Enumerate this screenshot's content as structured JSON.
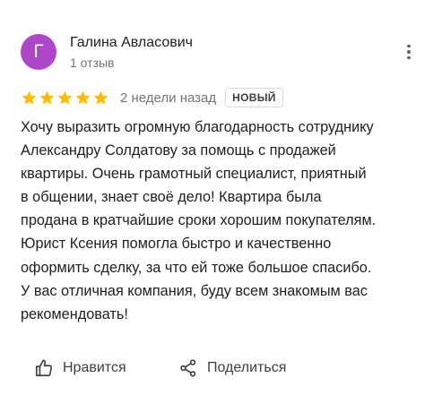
{
  "review": {
    "author": {
      "initial": "Г",
      "name": "Галина Авласович",
      "reviews_count": "1 отзыв",
      "avatar_color": "#ad47c8"
    },
    "menu_icon": "more-vert-icon",
    "rating": 5,
    "rating_max": 5,
    "star_color": "#fbbc04",
    "date": "2 недели назад",
    "badge": "НОВЫЙ",
    "text": "Хочу выразить огромную благодарность сотруднику\nАлександру Солдатову за помощь с продажей\nквартиры. Очень грамотный специалист, приятный\nв общении, знает своё дело! Квартира была\nпродана в кратчайшие сроки хорошим покупателям.\nЮрист Ксения помогла быстро и качественно\nоформить сделку, за что ей тоже большое спасибо.\nУ вас отличная компания, буду всем знакомым вас\nрекомендовать!"
  },
  "actions": {
    "like": {
      "label": "Нравится",
      "icon": "thumb-up-icon"
    },
    "share": {
      "label": "Поделиться",
      "icon": "share-icon"
    }
  }
}
